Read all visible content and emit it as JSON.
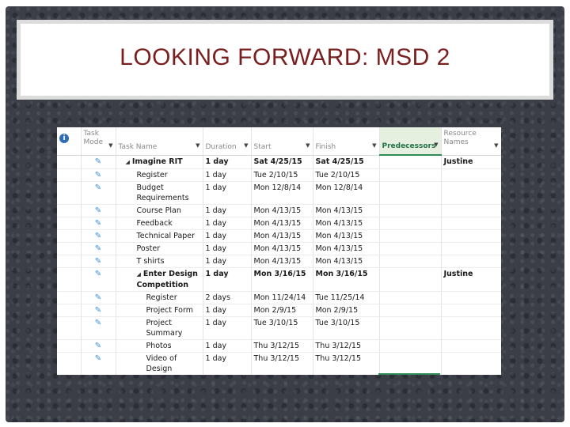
{
  "title": "LOOKING FORWARD: MSD 2",
  "table": {
    "headers": {
      "info_icon": "i",
      "task_mode": "Task Mode",
      "task_name": "Task Name",
      "duration": "Duration",
      "start": "Start",
      "finish": "Finish",
      "predecessors": "Predecessors",
      "resource_names": "Resource Names"
    },
    "rows": [
      {
        "name": "Imagine RIT",
        "duration": "1 day",
        "start": "Sat 4/25/15",
        "finish": "Sat 4/25/15",
        "predecessors": "",
        "resource": "Justine",
        "summary": true,
        "level": 1
      },
      {
        "name": "Register",
        "duration": "1 day",
        "start": "Tue 2/10/15",
        "finish": "Tue 2/10/15",
        "predecessors": "",
        "resource": "",
        "summary": false,
        "level": 2
      },
      {
        "name": "Budget Requirements",
        "duration": "1 day",
        "start": "Mon 12/8/14",
        "finish": "Mon 12/8/14",
        "predecessors": "",
        "resource": "",
        "summary": false,
        "level": 2
      },
      {
        "name": "Course Plan",
        "duration": "1 day",
        "start": "Mon 4/13/15",
        "finish": "Mon 4/13/15",
        "predecessors": "",
        "resource": "",
        "summary": false,
        "level": 2
      },
      {
        "name": "Feedback",
        "duration": "1 day",
        "start": "Mon 4/13/15",
        "finish": "Mon 4/13/15",
        "predecessors": "",
        "resource": "",
        "summary": false,
        "level": 2
      },
      {
        "name": "Technical Paper",
        "duration": "1 day",
        "start": "Mon 4/13/15",
        "finish": "Mon 4/13/15",
        "predecessors": "",
        "resource": "",
        "summary": false,
        "level": 2
      },
      {
        "name": "Poster",
        "duration": "1 day",
        "start": "Mon 4/13/15",
        "finish": "Mon 4/13/15",
        "predecessors": "",
        "resource": "",
        "summary": false,
        "level": 2
      },
      {
        "name": "T shirts",
        "duration": "1 day",
        "start": "Mon 4/13/15",
        "finish": "Mon 4/13/15",
        "predecessors": "",
        "resource": "",
        "summary": false,
        "level": 2
      },
      {
        "name": "Enter Design Competition",
        "duration": "1 day",
        "start": "Mon 3/16/15",
        "finish": "Mon 3/16/15",
        "predecessors": "",
        "resource": "Justine",
        "summary": true,
        "level": 2
      },
      {
        "name": "Register",
        "duration": "2 days",
        "start": "Mon 11/24/14",
        "finish": "Tue 11/25/14",
        "predecessors": "",
        "resource": "",
        "summary": false,
        "level": 3
      },
      {
        "name": "Project Form",
        "duration": "1 day",
        "start": "Mon 2/9/15",
        "finish": "Mon 2/9/15",
        "predecessors": "",
        "resource": "",
        "summary": false,
        "level": 3
      },
      {
        "name": "Project Summary",
        "duration": "1 day",
        "start": "Tue 3/10/15",
        "finish": "Tue 3/10/15",
        "predecessors": "",
        "resource": "",
        "summary": false,
        "level": 3
      },
      {
        "name": "Photos",
        "duration": "1 day",
        "start": "Thu 3/12/15",
        "finish": "Thu 3/12/15",
        "predecessors": "",
        "resource": "",
        "summary": false,
        "level": 3
      },
      {
        "name": "Video of Design",
        "duration": "1 day",
        "start": "Thu 3/12/15",
        "finish": "Thu 3/12/15",
        "predecessors": "",
        "resource": "",
        "summary": false,
        "level": 3
      }
    ]
  },
  "icons": {
    "task_mode": "pushpin-icon",
    "collapse": "collapse-triangle-icon",
    "dropdown": "dropdown-arrow-icon"
  },
  "colors": {
    "title": "#7a1f1f",
    "predecessors_header": "#217346",
    "task_mode_icon": "#3a8fd9",
    "background": "#3b3e47"
  }
}
